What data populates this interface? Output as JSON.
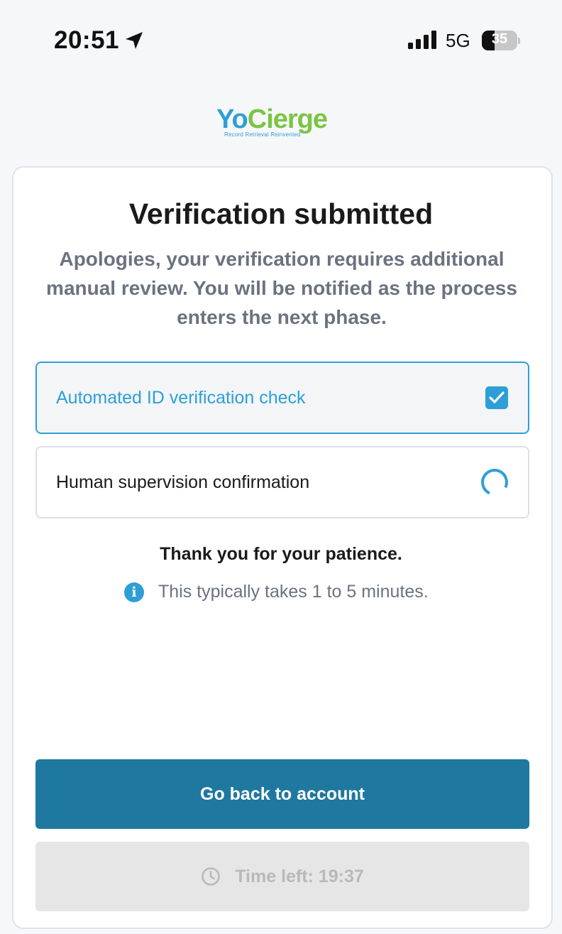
{
  "status_bar": {
    "time": "20:51",
    "network": "5G",
    "battery": 35
  },
  "logo": {
    "name_part1": "Yo",
    "name_part2": "Cierge",
    "tagline": "Record Retrieval Reinvented"
  },
  "card": {
    "title": "Verification submitted",
    "subtitle": "Apologies, your verification requires additional manual review. You will be notified as the process enters the next phase.",
    "steps": [
      {
        "label": "Automated ID verification check",
        "state": "complete",
        "icon": "checkbox-checked-icon"
      },
      {
        "label": "Human supervision confirmation",
        "state": "in-progress",
        "icon": "spinner-icon"
      }
    ],
    "thanks": "Thank you for your patience.",
    "hint": "This typically takes 1 to 5 minutes.",
    "primary_button": "Go back to account",
    "timer_label": "Time left: 19:37"
  },
  "colors": {
    "accent": "#2e9fd6",
    "primary_button": "#1f789f",
    "brand_green": "#7cc444"
  }
}
